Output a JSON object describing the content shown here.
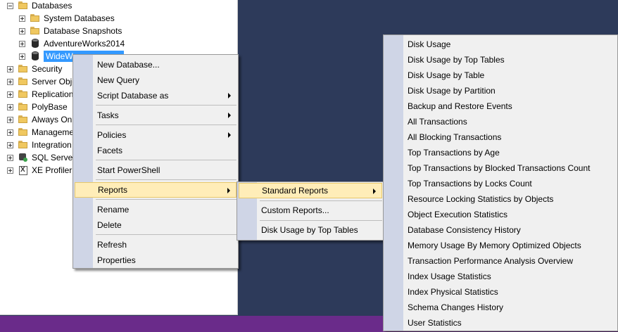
{
  "tree": {
    "items": [
      {
        "label": "Databases",
        "expander": "minus",
        "icon": "folder-icon"
      },
      {
        "label": "System Databases",
        "expander": "plus",
        "icon": "folder-icon"
      },
      {
        "label": "Database Snapshots",
        "expander": "plus",
        "icon": "folder-icon"
      },
      {
        "label": "AdventureWorks2014",
        "expander": "plus",
        "icon": "database-icon"
      },
      {
        "label": "WideW",
        "expander": "plus",
        "icon": "database-icon",
        "selected": true
      },
      {
        "label": "Security",
        "expander": "plus",
        "icon": "folder-icon"
      },
      {
        "label": "Server Obje",
        "expander": "plus",
        "icon": "folder-icon"
      },
      {
        "label": "Replication",
        "expander": "plus",
        "icon": "folder-icon"
      },
      {
        "label": "PolyBase",
        "expander": "plus",
        "icon": "folder-icon"
      },
      {
        "label": "Always On",
        "expander": "plus",
        "icon": "folder-icon"
      },
      {
        "label": "Manageme",
        "expander": "plus",
        "icon": "folder-icon"
      },
      {
        "label": "Integration",
        "expander": "plus",
        "icon": "folder-icon"
      },
      {
        "label": "SQL Server",
        "expander": "plus",
        "icon": "sql-agent-icon"
      },
      {
        "label": "XE Profiler",
        "expander": "plus",
        "icon": "xe-profiler-icon"
      }
    ]
  },
  "context_menu": {
    "new_database": "New Database...",
    "new_query": "New Query",
    "script_database_as": "Script Database as",
    "tasks": "Tasks",
    "policies": "Policies",
    "facets": "Facets",
    "start_powershell": "Start PowerShell",
    "reports": "Reports",
    "rename": "Rename",
    "delete": "Delete",
    "refresh": "Refresh",
    "properties": "Properties"
  },
  "reports_menu": {
    "standard_reports": "Standard Reports",
    "custom_reports": "Custom Reports...",
    "disk_usage_top_tables": "Disk Usage by Top Tables"
  },
  "standard_reports_menu": {
    "items": [
      "Disk Usage",
      "Disk Usage by Top Tables",
      "Disk Usage by Table",
      "Disk Usage by Partition",
      "Backup and Restore Events",
      "All Transactions",
      "All Blocking Transactions",
      "Top Transactions by Age",
      "Top Transactions by Blocked Transactions Count",
      "Top Transactions by Locks Count",
      "Resource Locking Statistics by Objects",
      "Object Execution Statistics",
      "Database Consistency History",
      "Memory Usage By Memory Optimized Objects",
      "Transaction Performance Analysis Overview",
      "Index Usage Statistics",
      "Index Physical Statistics",
      "Schema Changes History",
      "User Statistics"
    ]
  },
  "colors": {
    "background": "#2d3a5a",
    "taskbar": "#6a2b8a",
    "highlight": "#ffedb8",
    "selection": "#3399ff"
  }
}
